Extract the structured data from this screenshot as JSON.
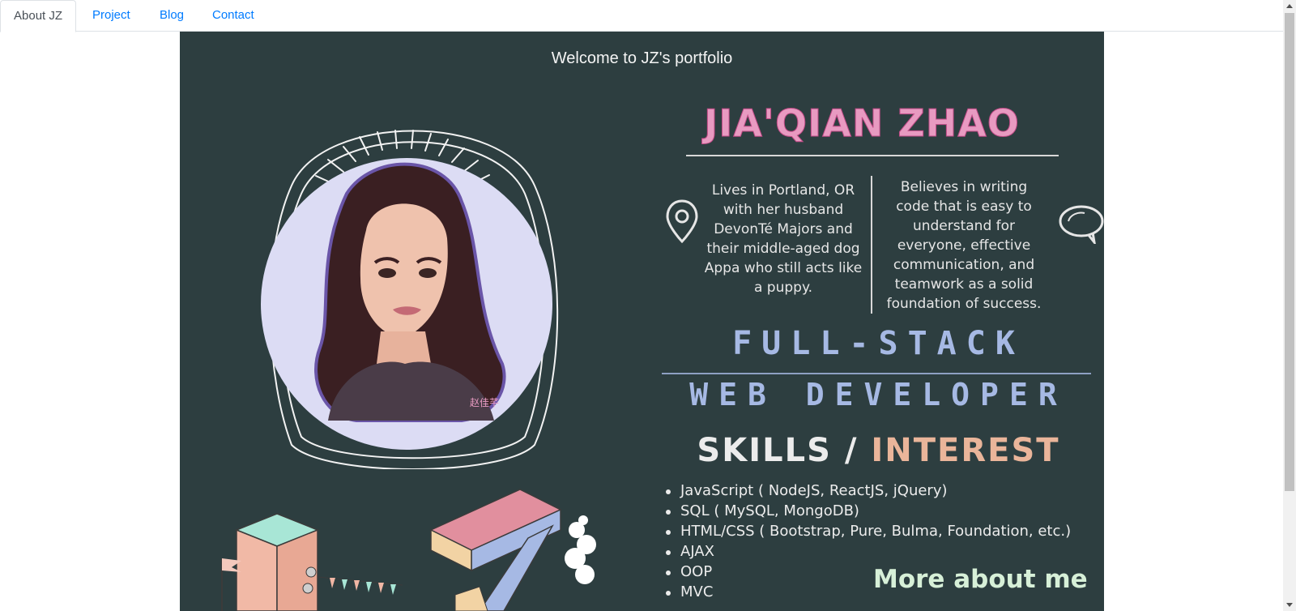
{
  "tabs": [
    {
      "label": "About JZ",
      "active": true
    },
    {
      "label": "Project",
      "active": false
    },
    {
      "label": "Blog",
      "active": false
    },
    {
      "label": "Contact",
      "active": false
    }
  ],
  "welcome": "Welcome to JZ's portfolio",
  "profile": {
    "name": "JIA'QIAN ZHAO",
    "signature": "赵佳芊",
    "blurb_left": "Lives in Portland, OR with her husband DevonTé Majors and their middle-aged dog Appa who still acts like a puppy.",
    "blurb_right": "Believes in writing code that is easy to understand for everyone, effective communication, and teamwork as a solid foundation of success.",
    "title_line1": "FULL-STACK",
    "title_line2": "WEB DEVELOPER",
    "skills_word": "SKILLS",
    "skills_sep": "/",
    "interest_word": "INTEREST",
    "skills": [
      "JavaScript ( NodeJS, ReactJS, jQuery)",
      "SQL ( MySQL, MongoDB)",
      "HTML/CSS ( Bootstrap, Pure, Bulma, Foundation, etc.)",
      "AJAX",
      "OOP",
      "MVC"
    ],
    "more_heading": "More about me"
  },
  "icons": {
    "location": "map-pin-icon",
    "speech": "speech-bubble-icon"
  },
  "colors": {
    "panel_bg": "#2d3e40",
    "name_pink": "#e89ac1",
    "title_blue": "#a6b9e4",
    "interest_peach": "#eab59a",
    "more_green": "#d7f0d8",
    "link_blue": "#007bff"
  }
}
